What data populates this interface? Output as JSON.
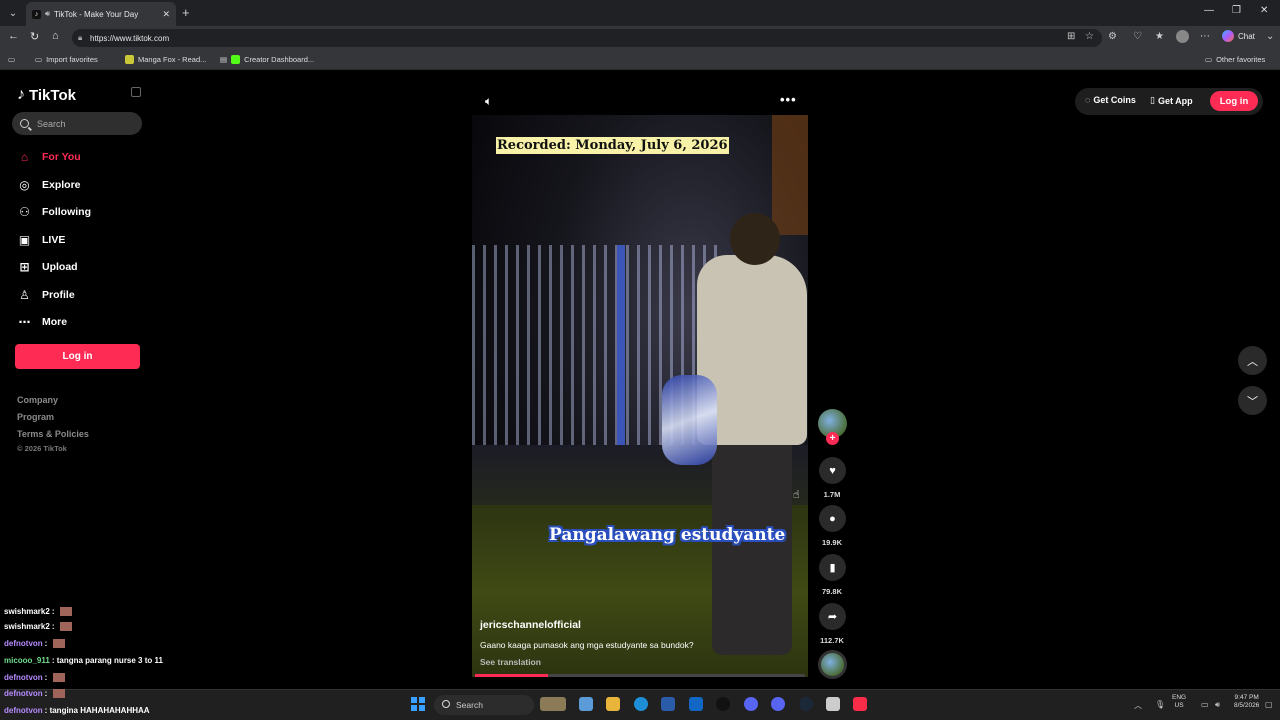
{
  "browser": {
    "tab_title": "TikTok - Make Your Day",
    "url": "https://www.tiktok.com",
    "chat_label": "Chat",
    "bookmarks": [
      "Import favorites",
      "Manga Fox - Read...",
      "Creator Dashboard..."
    ],
    "other_favorites": "Other favorites"
  },
  "sidebar": {
    "logo": "TikTok",
    "search_placeholder": "Search",
    "items": [
      {
        "label": "For You",
        "icon": "home-icon",
        "active": true
      },
      {
        "label": "Explore",
        "icon": "compass-icon"
      },
      {
        "label": "Following",
        "icon": "following-icon"
      },
      {
        "label": "LIVE",
        "icon": "live-icon"
      },
      {
        "label": "Upload",
        "icon": "upload-icon"
      },
      {
        "label": "Profile",
        "icon": "profile-icon"
      },
      {
        "label": "More",
        "icon": "more-icon"
      }
    ],
    "login_label": "Log in",
    "footer": [
      "Company",
      "Program",
      "Terms & Policies"
    ],
    "copyright": "© 2026 TikTok"
  },
  "header": {
    "get_coins": "Get Coins",
    "get_app": "Get App",
    "login": "Log in"
  },
  "video": {
    "recorded_caption": "Recorded: Monday, July 6, 2026",
    "subtitle": "Pangalawang estudyante",
    "author": "jericschannelofficial",
    "description": "Gaano kaaga pumasok ang mga estudyante sa bundok?",
    "see_translation": "See translation",
    "progress": 0.22,
    "likes": "1.7M",
    "comments": "19.9K",
    "saves": "79.8K",
    "shares": "112.7K"
  },
  "chat_overlay": [
    {
      "user": "swishmark2",
      "message": "",
      "color": "#ffffff"
    },
    {
      "user": "swishmark2",
      "message": "",
      "color": "#ffffff"
    },
    {
      "user": "defnotvon",
      "message": "",
      "color": "#b68cff"
    },
    {
      "user": "micooo_911",
      "message": "tangna parang nurse 3 to 11",
      "color": "#6fdc8c"
    },
    {
      "user": "defnotvon",
      "message": "",
      "color": "#b68cff"
    },
    {
      "user": "defnotvon",
      "message": "",
      "color": "#b68cff"
    },
    {
      "user": "defnotvon",
      "message": "tangina HAHAHAHAHHAA",
      "color": "#b68cff"
    }
  ],
  "taskbar": {
    "search": "Search",
    "lang_top": "ENG",
    "lang_bottom": "US",
    "time": "9:47 PM",
    "date": "8/5/2026"
  },
  "colors": {
    "accent": "#fe2c55",
    "page_bg": "#000000",
    "chrome_bg": "#35363a"
  }
}
